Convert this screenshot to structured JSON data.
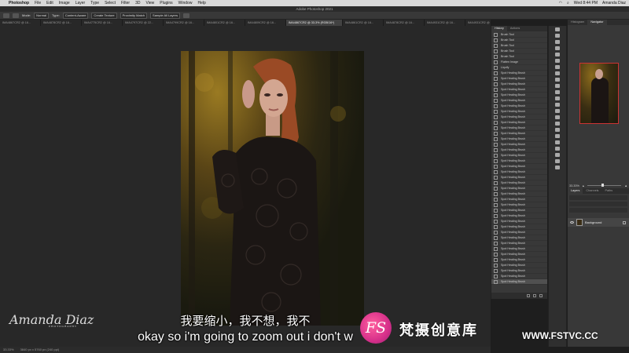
{
  "menubar": {
    "app": "Photoshop",
    "items": [
      "File",
      "Edit",
      "Image",
      "Layer",
      "Type",
      "Select",
      "Filter",
      "3D",
      "View",
      "Plugins",
      "Window",
      "Help"
    ],
    "clock": "Wed 8:44 PM",
    "user": "Amanda Diaz"
  },
  "window": {
    "title": "Adobe Photoshop 2021"
  },
  "options": {
    "mode_label": "Mode:",
    "mode_value": "Normal",
    "type_label": "Type:",
    "btn_content_aware": "Content-Aware",
    "btn_create_texture": "Create Texture",
    "btn_proximity": "Proximity Match",
    "sample_all": "Sample All Layers"
  },
  "tabs": [
    {
      "label": "IMA4867CR2 @ 16...",
      "active": false
    },
    {
      "label": "IMA4878CR2 @ 16...",
      "active": false
    },
    {
      "label": "IMA4775CR2 @ 16...",
      "active": false
    },
    {
      "label": "IMA4797CR2 @ 22...",
      "active": false
    },
    {
      "label": "IMA4799CR2 @ 16...",
      "active": false
    },
    {
      "label": "IMA4801CR2 @ 16...",
      "active": false
    },
    {
      "label": "IMA4809CR2 @ 16...",
      "active": false
    },
    {
      "label": "IMA4867CR2 @ 33.3% (RGB/16*)",
      "active": true
    },
    {
      "label": "IMA4861CR2 @ 16...",
      "active": false
    },
    {
      "label": "IMA4878CR2 @ 16...",
      "active": false
    },
    {
      "label": "IMA4931CR2 @ 16...",
      "active": false
    },
    {
      "label": "IMA4931CR2 @ 16...",
      "active": false
    }
  ],
  "history": {
    "tabs": [
      "History",
      "Actions"
    ],
    "items": [
      "Brush Tool",
      "Brush Tool",
      "Brush Tool",
      "Brush Tool",
      "Brush Tool",
      "Flatten Image",
      "Liquify",
      "Spot Healing Brush",
      "Spot Healing Brush",
      "Spot Healing Brush",
      "Spot Healing Brush",
      "Spot Healing Brush",
      "Spot Healing Brush",
      "Spot Healing Brush",
      "Spot Healing Brush",
      "Spot Healing Brush",
      "Spot Healing Brush",
      "Spot Healing Brush",
      "Spot Healing Brush",
      "Spot Healing Brush",
      "Spot Healing Brush",
      "Spot Healing Brush",
      "Spot Healing Brush",
      "Spot Healing Brush",
      "Spot Healing Brush",
      "Spot Healing Brush",
      "Spot Healing Brush",
      "Spot Healing Brush",
      "Spot Healing Brush",
      "Spot Healing Brush",
      "Spot Healing Brush",
      "Spot Healing Brush",
      "Spot Healing Brush",
      "Spot Healing Brush",
      "Spot Healing Brush",
      "Spot Healing Brush",
      "Spot Healing Brush",
      "Spot Healing Brush",
      "Spot Healing Brush",
      "Spot Healing Brush",
      "Spot Healing Brush",
      "Spot Healing Brush",
      "Spot Healing Brush",
      "Spot Healing Brush",
      "Spot Healing Brush",
      "Spot Healing Brush"
    ],
    "selected_index": 46
  },
  "right": {
    "top_tabs": [
      "Histogram",
      "Navigator"
    ],
    "zoom": "33.33%",
    "layer_tabs": [
      "Layers",
      "Channels",
      "Paths"
    ],
    "layer_name": "Background"
  },
  "status": {
    "zoom": "33.33%",
    "doc": "3840 px x 5760 px (240 ppi)"
  },
  "subtitles": {
    "cn": "我要缩小，我不想，我不",
    "en": "okay so i'm going to zoom out i don't w"
  },
  "watermark": {
    "signature": "Amanda Diaz",
    "signature_sub": "PHOTOGRAPHY",
    "logo": "FS",
    "brand_cn": "梵摄创意库",
    "url": "WWW.FSTVC.CC"
  }
}
